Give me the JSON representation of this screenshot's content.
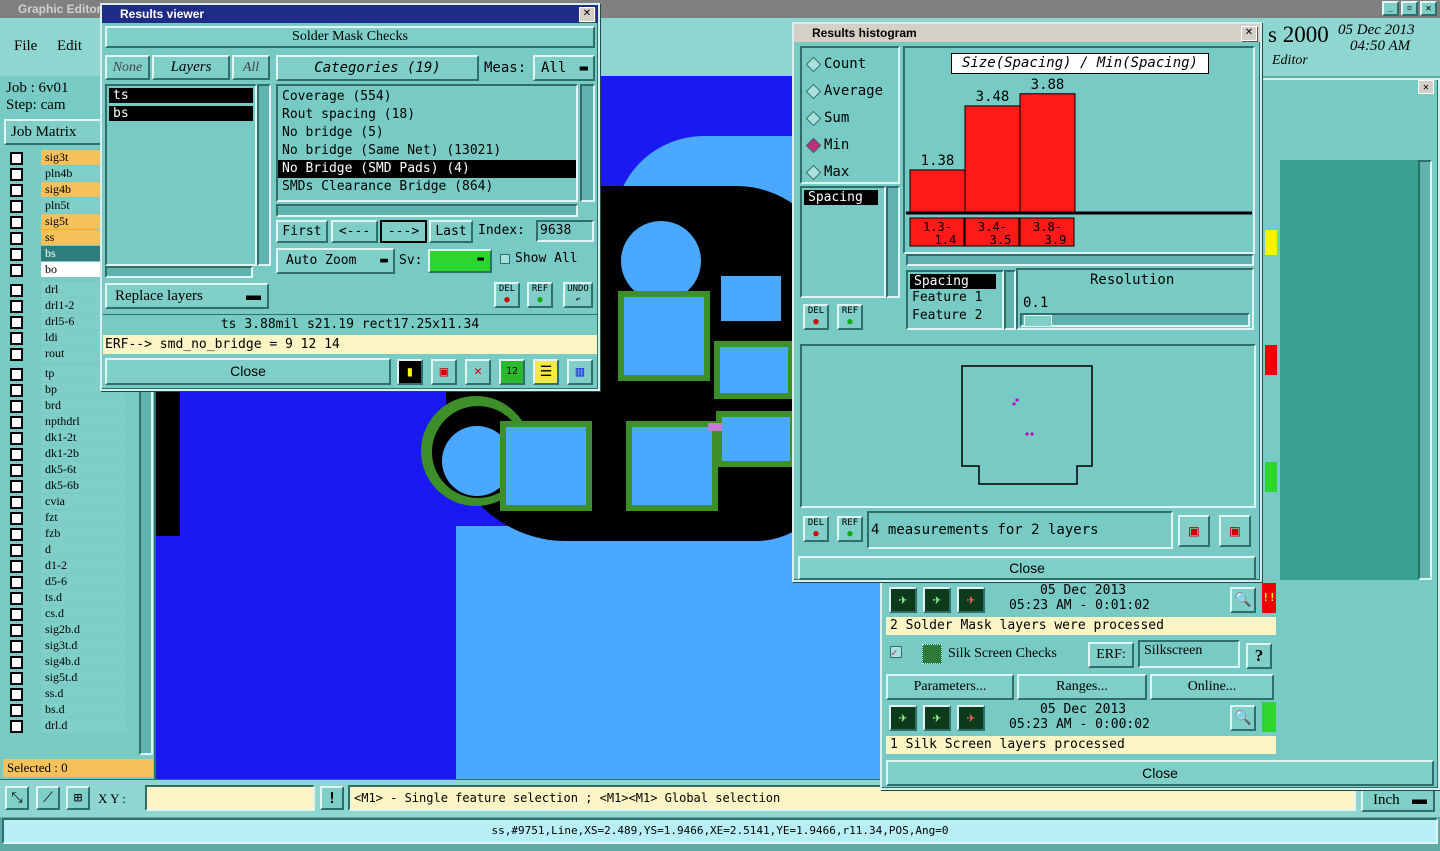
{
  "graphic_editor": {
    "title": "Graphic Editor",
    "menu": [
      "File",
      "Edit"
    ],
    "job_label": "Job : 6v01",
    "step_label": "Step: cam",
    "job_matrix": "Job Matrix",
    "layers": [
      {
        "name": "sig3t",
        "color": "y"
      },
      {
        "name": "pln4b",
        "color": ""
      },
      {
        "name": "sig4b",
        "color": "y"
      },
      {
        "name": "pln5t",
        "color": ""
      },
      {
        "name": "sig5t",
        "color": "y"
      },
      {
        "name": "ss",
        "color": "y"
      },
      {
        "name": "bs",
        "color": "t"
      },
      {
        "name": "bo",
        "color": "w"
      },
      {
        "name": "drl",
        "color": ""
      },
      {
        "name": "drl1-2",
        "color": ""
      },
      {
        "name": "drl5-6",
        "color": ""
      },
      {
        "name": "ldi",
        "color": ""
      },
      {
        "name": "rout",
        "color": ""
      },
      {
        "name": "tp",
        "color": ""
      },
      {
        "name": "bp",
        "color": ""
      },
      {
        "name": "brd",
        "color": ""
      },
      {
        "name": "npthdrl",
        "color": ""
      },
      {
        "name": "dk1-2t",
        "color": ""
      },
      {
        "name": "dk1-2b",
        "color": ""
      },
      {
        "name": "dk5-6t",
        "color": ""
      },
      {
        "name": "dk5-6b",
        "color": ""
      },
      {
        "name": "cvia",
        "color": ""
      },
      {
        "name": "fzt",
        "color": ""
      },
      {
        "name": "fzb",
        "color": ""
      },
      {
        "name": "d",
        "color": ""
      },
      {
        "name": "d1-2",
        "color": ""
      },
      {
        "name": "d5-6",
        "color": ""
      },
      {
        "name": "ts.d",
        "color": ""
      },
      {
        "name": "cs.d",
        "color": ""
      },
      {
        "name": "sig2b.d",
        "color": ""
      },
      {
        "name": "sig3t.d",
        "color": ""
      },
      {
        "name": "sig4b.d",
        "color": ""
      },
      {
        "name": "sig5t.d",
        "color": ""
      },
      {
        "name": "ss.d",
        "color": ""
      },
      {
        "name": "bs.d",
        "color": ""
      },
      {
        "name": "drl.d",
        "color": ""
      }
    ],
    "selected": "Selected : 0",
    "xy_label": "X Y :",
    "hint": "<M1> - Single feature selection ; <M1><M1> Global selection",
    "units": "Inch",
    "status_line": "ss,#9751,Line,XS=2.489,YS=1.9466,XE=2.5141,YE=1.9466,r11.34,POS,Ang=0",
    "top_right_date": "05 Dec 2013",
    "top_right_time": "04:50 AM",
    "top_right_brand": "s 2000",
    "top_right_sub": "Editor"
  },
  "results_viewer": {
    "title": "Results viewer",
    "header": "Solder Mask Checks",
    "none": "None",
    "layers": "Layers",
    "all": "All",
    "layer_items": [
      "ts",
      "bs"
    ],
    "replace_layers": "Replace layers",
    "categories_label": "Categories (19)",
    "meas_label": "Meas:",
    "meas_value": "All",
    "categories": [
      "Coverage (554)",
      "Rout spacing (18)",
      "No bridge (5)",
      "No bridge (Same Net) (13021)",
      "No Bridge (SMD Pads) (4)",
      "SMDs Clearance Bridge (864)"
    ],
    "selected_category": 4,
    "first": "First",
    "prev": "<---",
    "next": "--->",
    "last": "Last",
    "index_label": "Index:",
    "index_value": "9638",
    "auto_zoom": "Auto Zoom",
    "sv_label": "Sv:",
    "show_all": "Show All",
    "del": "DEL",
    "ref": "REF",
    "undo": "UNDO",
    "status": "ts 3.88mil   s21.19   rect17.25x11.34",
    "erf": "ERF--> smd_no_bridge = 9 12 14",
    "close": "Close"
  },
  "histogram": {
    "title": "Results histogram",
    "radios": [
      "Count",
      "Average",
      "Sum",
      "Min",
      "Max"
    ],
    "selected_radio": 3,
    "spacing_item": "Spacing",
    "chart_title": "Size(Spacing) / Min(Spacing)",
    "chart_data": {
      "type": "bar",
      "categories": [
        "1.3-1.4",
        "3.4-3.5",
        "3.8-3.9"
      ],
      "values": [
        1.38,
        3.48,
        3.88
      ],
      "title": "Size(Spacing) / Min(Spacing)",
      "ylim": [
        0,
        4.2
      ]
    },
    "bar_labels": [
      "1.38",
      "3.48",
      "3.88"
    ],
    "cat_top": [
      "1.3-",
      "3.4-",
      "3.8-"
    ],
    "cat_bot": [
      "1.4",
      "3.5",
      "3.9"
    ],
    "attr_items": [
      "Spacing",
      "Feature 1",
      "Feature 2"
    ],
    "resolution_label": "Resolution",
    "resolution_value": "0.1",
    "measurements": "4 measurements for 2 layers",
    "del": "DEL",
    "ref": "REF",
    "close": "Close"
  },
  "checklist": {
    "run1_date": "05 Dec 2013",
    "run1_time": "05:23 AM - 0:01:02",
    "run1_msg": "2 Solder Mask layers were processed",
    "silk_label": "Silk Screen Checks",
    "erf_label": "ERF:",
    "erf_value": "Silkscreen",
    "parameters": "Parameters...",
    "ranges": "Ranges...",
    "online": "Online...",
    "run2_date": "05 Dec 2013",
    "run2_time": "05:23 AM - 0:00:02",
    "run2_msg": "1 Silk Screen layers processed",
    "close": "Close",
    "help": "?"
  }
}
